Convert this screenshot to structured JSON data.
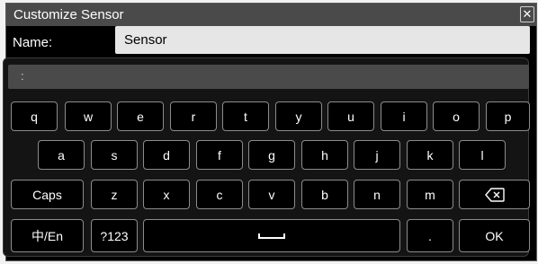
{
  "dialog": {
    "title": "Customize Sensor",
    "close_glyph": "✕",
    "name_label": "Name:",
    "name_value": "Sensor"
  },
  "candidate_bar": {
    "text": ":"
  },
  "keys": {
    "row1": [
      "q",
      "w",
      "e",
      "r",
      "t",
      "y",
      "u",
      "i",
      "o",
      "p"
    ],
    "row2": [
      "a",
      "s",
      "d",
      "f",
      "g",
      "h",
      "j",
      "k",
      "l"
    ],
    "row3": [
      "Caps",
      "z",
      "x",
      "c",
      "v",
      "b",
      "n",
      "m"
    ],
    "backspace_icon": "backspace-icon",
    "lang_toggle": "中/En",
    "numeric": "?123",
    "space_icon": "space-bar-icon",
    "period": ".",
    "ok": "OK"
  }
}
